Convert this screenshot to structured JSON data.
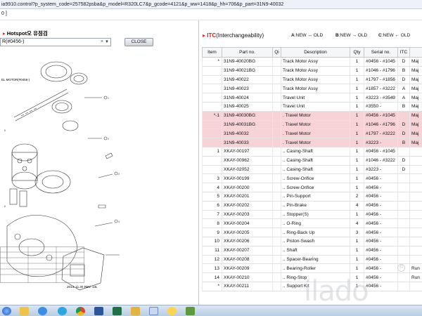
{
  "browser": {
    "url": "ia9910.control?p_system_code=257582psba&p_model=R320LC7&p_gcode=4121&p_ww=1418&p_hh=706&p_part=31N9-40032",
    "subbar_text": "0 ]"
  },
  "left_panel": {
    "hotspot_label": "Hotspot오 유점검",
    "model_select_value": "R(#0456-)",
    "close_button": "CLOSE",
    "diagram_title": "EL MOTOR(#0456-)",
    "diagram_footer": "2013. 11.30 REV. 13L"
  },
  "right_panel": {
    "itc_title": "ITC",
    "itc_subtitle": "(Interchangeability)",
    "legend": [
      {
        "key": "A",
        "text": ":NEW ↔ OLD"
      },
      {
        "key": "B",
        "text": ":NEW → OLD"
      },
      {
        "key": "C",
        "text": ":NEW ← OLD"
      }
    ],
    "columns": [
      "Item",
      "Part no.",
      "Qi",
      "Description",
      "Qty",
      "Serial no.",
      "ITC",
      "Li"
    ],
    "rows": [
      {
        "item": "*",
        "part": "31N9-40020BG",
        "desc": "Track Motor Assy",
        "qty": "1",
        "serial": "#0456 - #1045",
        "itc": "D",
        "li": "Maj",
        "hl": false
      },
      {
        "item": "",
        "part": "31N9-40021BG",
        "desc": "Track Motor Assy",
        "qty": "1",
        "serial": "#1046 - #1796",
        "itc": "B",
        "li": "Maj",
        "hl": false
      },
      {
        "item": "",
        "part": "31N9-40022",
        "desc": "Track Motor Assy",
        "qty": "1",
        "serial": "#1797 - #1856",
        "itc": "D",
        "li": "Maj",
        "hl": false
      },
      {
        "item": "",
        "part": "31N9-40023",
        "desc": "Track Motor Assy",
        "qty": "1",
        "serial": "#1857 - #3222",
        "itc": "A",
        "li": "Maj",
        "hl": false
      },
      {
        "item": "",
        "part": "31N9-40024",
        "desc": "Travel Unit",
        "qty": "1",
        "serial": "#3223 - #3549",
        "itc": "A",
        "li": "Maj",
        "hl": false
      },
      {
        "item": "",
        "part": "31N9-40025",
        "desc": "Travel Unit",
        "qty": "1",
        "serial": "#3550 -",
        "itc": "B",
        "li": "Maj",
        "hl": false
      },
      {
        "item": "*-1",
        "part": "31N9-40030BG",
        "desc": ". Travel Motor",
        "qty": "1",
        "serial": "#0456 - #1045",
        "itc": "",
        "li": "Maj",
        "hl": true
      },
      {
        "item": "",
        "part": "31N9-40031BG",
        "desc": ". Travel Motor",
        "qty": "1",
        "serial": "#1046 - #1796",
        "itc": "D",
        "li": "Maj",
        "hl": true
      },
      {
        "item": "",
        "part": "31N9-40032",
        "desc": ". Travel Motor",
        "qty": "1",
        "serial": "#1797 - #3222",
        "itc": "D",
        "li": "Maj",
        "hl": true
      },
      {
        "item": "",
        "part": "31N9-40033",
        "desc": ". Travel Motor",
        "qty": "1",
        "serial": "#3223 -",
        "itc": "B",
        "li": "Maj",
        "hl": true
      },
      {
        "item": "1",
        "part": "XKAY-00197",
        "desc": ".. Casing-Shaft",
        "qty": "1",
        "serial": "#0456 - #1045",
        "itc": "",
        "li": "",
        "hl": false
      },
      {
        "item": "",
        "part": "XKAY-00962",
        "desc": ".. Casing-Shaft",
        "qty": "1",
        "serial": "#1046 - #3222",
        "itc": "D",
        "li": "",
        "hl": false
      },
      {
        "item": "",
        "part": "XKAY-02052",
        "desc": ".. Casing-Shaft",
        "qty": "1",
        "serial": "#3223 -",
        "itc": "D",
        "li": "",
        "hl": false
      },
      {
        "item": "3",
        "part": "XKAY-00199",
        "desc": ".. Screw-Orifice",
        "qty": "1",
        "serial": "#0456 -",
        "itc": "",
        "li": "",
        "hl": false
      },
      {
        "item": "4",
        "part": "XKAY-00200",
        "desc": ".. Screw-Orifice",
        "qty": "1",
        "serial": "#0456 -",
        "itc": "",
        "li": "",
        "hl": false
      },
      {
        "item": "5",
        "part": "XKAY-00201",
        "desc": ".. Pin-Support",
        "qty": "2",
        "serial": "#0456 -",
        "itc": "",
        "li": "",
        "hl": false
      },
      {
        "item": "6",
        "part": "XKAY-00202",
        "desc": ".. Pin-Brake",
        "qty": "4",
        "serial": "#0456 -",
        "itc": "",
        "li": "",
        "hl": false
      },
      {
        "item": "7",
        "part": "XKAY-00203",
        "desc": ".. Stopper(S)",
        "qty": "1",
        "serial": "#0456 -",
        "itc": "",
        "li": "",
        "hl": false
      },
      {
        "item": "8",
        "part": "XKAY-00204",
        "desc": ".. O-Ring",
        "qty": "4",
        "serial": "#0456 -",
        "itc": "",
        "li": "",
        "hl": false
      },
      {
        "item": "9",
        "part": "XKAY-00205",
        "desc": ".. Ring-Back Up",
        "qty": "3",
        "serial": "#0456 -",
        "itc": "",
        "li": "",
        "hl": false
      },
      {
        "item": "10",
        "part": "XKAY-00206",
        "desc": ".. Piston-Swash",
        "qty": "1",
        "serial": "#0456 -",
        "itc": "",
        "li": "",
        "hl": false
      },
      {
        "item": "11",
        "part": "XKAY-00207",
        "desc": ".. Shaft",
        "qty": "1",
        "serial": "#0456 -",
        "itc": "",
        "li": "",
        "hl": false
      },
      {
        "item": "12",
        "part": "XKAY-00208",
        "desc": ".. Spacer-Bearing",
        "qty": "1",
        "serial": "#0456 -",
        "itc": "",
        "li": "",
        "hl": false
      },
      {
        "item": "13",
        "part": "XKAY-00209",
        "desc": ".. Bearing-Roller",
        "qty": "1",
        "serial": "#0456 -",
        "itc": "",
        "li": "Run",
        "hl": false
      },
      {
        "item": "14",
        "part": "XKAY-00210",
        "desc": ".. Ring-Stop",
        "qty": "1",
        "serial": "#0456 -",
        "itc": "",
        "li": "Run",
        "hl": false
      },
      {
        "item": "*",
        "part": "XKAY-00211",
        "desc": ".. Support Kit",
        "qty": "1",
        "serial": "#0456 -",
        "itc": "",
        "li": "",
        "hl": false
      }
    ]
  },
  "watermark": "ilado",
  "watermark_mark": "©",
  "colors": {
    "highlight_row": "#f7d3d6",
    "itc_red": "#d02010",
    "accent_arrow": "#e03020"
  },
  "taskbar_icons": [
    "start-orb-icon",
    "explorer-icon",
    "ie-icon",
    "skype-icon",
    "chrome-icon",
    "word-icon",
    "excel-icon",
    "folder-icon",
    "paint-icon",
    "chat-icon",
    "app-icon"
  ]
}
